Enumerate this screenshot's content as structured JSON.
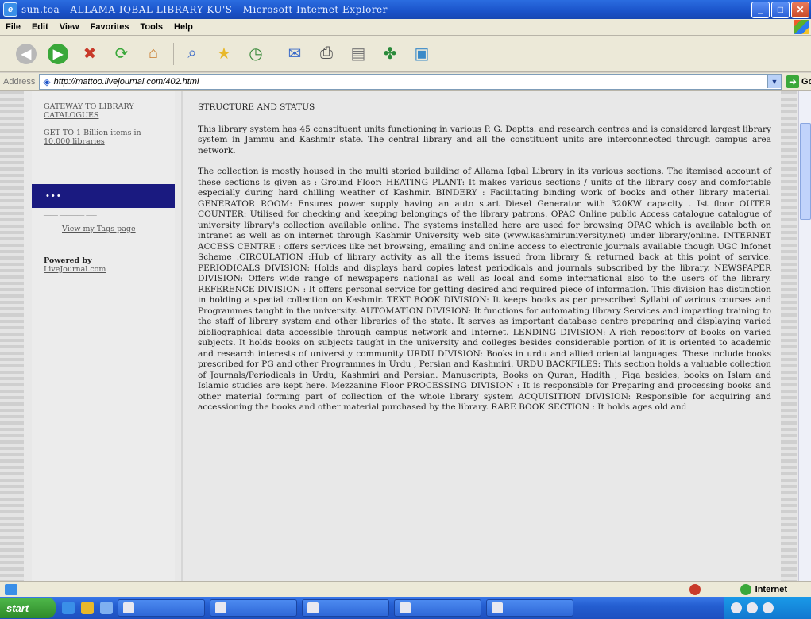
{
  "window": {
    "title": "sun.toa - ALLAMA IQBAL LIBRARY KU'S - Microsoft Internet Explorer"
  },
  "menubar": {
    "items": [
      "File",
      "Edit",
      "View",
      "Favorites",
      "Tools",
      "Help"
    ]
  },
  "toolbar": {
    "icons": [
      "back-icon",
      "forward-icon",
      "stop-icon",
      "refresh-icon",
      "home-icon",
      "search-icon",
      "favorites-icon",
      "history-icon",
      "mail-icon",
      "print-icon",
      "edit-icon",
      "discuss-icon",
      "messenger-icon"
    ]
  },
  "addressbar": {
    "label": "Address",
    "url": "http://mattoo.livejournal.com/402.html",
    "go_label": "Go"
  },
  "sidebar": {
    "gateway_link": "GATEWAY TO LIBRARY CATALOGUES",
    "billion_link": "GET TO 1 Billion items in 10,000 libraries",
    "tags_link": "View my Tags page",
    "powered_by": "Powered by",
    "livejournal_link": "LiveJournal.com"
  },
  "article": {
    "heading": "STRUCTURE AND STATUS",
    "para1": "This library system has 45 constituent units functioning in various P. G. Deptts. and research centres and is considered largest library system in Jammu and Kashmir state. The central library and all the constituent units are interconnected through campus area network.",
    "para2": "The collection is mostly housed in the multi storied building of Allama Iqbal Library in its various sections. The itemised account of these sections is given as : Ground Floor: HEATING PLANT: It makes various sections / units of the library cosy and comfortable especially during hard chilling weather of Kashmir. BINDERY : Facilitating binding work of books and other library material. GENERATOR ROOM: Ensures power supply having an auto start Diesel Generator with 320KW capacity . Ist floor OUTER COUNTER: Utilised for checking and keeping belongings of the library patrons. OPAC Online public Access catalogue catalogue of university library's collection available online. The systems installed here are used for browsing OPAC which is available both on intranet as well as on internet through Kashmir University web site (www.kashmiruniversity.net) under library/online. INTERNET ACCESS CENTRE : offers services like net browsing, emailing and online access to electronic journals available though UGC Infonet Scheme .CIRCULATION :Hub of library activity as all the items issued from library & returned back at this point of service. PERIODICALS DIVISION: Holds and displays hard copies latest periodicals and journals subscribed by the library. NEWSPAPER DIVISION: Offers wide range of newspapers national as well as local and some international also to the users of the library. REFERENCE DIVISION : It offers personal service for getting desired and required piece of information. This division has distinction in holding a special collection on Kashmir. TEXT BOOK DIVISION: It keeps books as per prescribed Syllabi of various courses and Programmes taught in the university. AUTOMATION DIVISION: It functions for automating library Services and imparting training to the staff of library system and other libraries of the state. It serves as important database centre preparing and displaying varied bibliographical data accessible through campus network and Internet. LENDING DIVISION: A rich repository of books on varied subjects. It holds books on subjects taught in the university and colleges besides considerable portion of it is oriented to academic and research interests of university community URDU DIVISION: Books in urdu and allied oriental languages. These include books prescribed for PG and other Programmes in Urdu , Persian and Kashmiri. URDU BACKFILES: This section holds a valuable collection of Journals/Periodicals in Urdu, Kashmiri and Persian. Manuscripts, Books on Quran, Hadith , Fiqa besides, books on Islam and Islamic studies are kept here. Mezzanine Floor PROCESSING DIVISION : It is responsible for Preparing and processing books and other material forming part of collection of the whole library system ACQUISITION DIVISION: Responsible for acquiring and accessioning the books and other material purchased by the library. RARE BOOK SECTION : It holds ages old and"
  },
  "statusbar": {
    "zone": "Internet"
  },
  "taskbar": {
    "start_label": "start"
  }
}
